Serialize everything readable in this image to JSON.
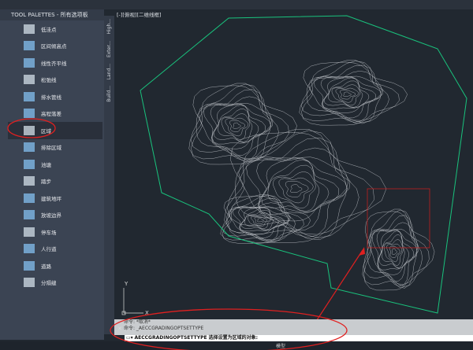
{
  "palette": {
    "title": "TOOL PALETTES - 所有选项板",
    "items": [
      {
        "label": "低洼点"
      },
      {
        "label": "区间倾高点"
      },
      {
        "label": "线性齐平线"
      },
      {
        "label": "松弛线"
      },
      {
        "label": "排水管线"
      },
      {
        "label": "高程落差"
      },
      {
        "label": "区域"
      },
      {
        "label": "排除区域"
      },
      {
        "label": "池塘"
      },
      {
        "label": "踏步"
      },
      {
        "label": "建筑地坪"
      },
      {
        "label": "放坡边界"
      },
      {
        "label": "停车场"
      },
      {
        "label": "人行道"
      },
      {
        "label": "道路"
      },
      {
        "label": "分隔缝"
      }
    ],
    "tabs": [
      "High...",
      "Exter...",
      "Land...",
      "Build..."
    ]
  },
  "viewport": {
    "label": "[-][俯视][二维线框]",
    "ucs_x": "X",
    "ucs_y": "Y"
  },
  "command": {
    "history": [
      "命令: *取消*",
      "命令: _AECCGRADINGOPTSETTYPE"
    ],
    "input": "AECCGRADINGOPTSETTYPE 选择设置为区域的对象:"
  },
  "status": {
    "model": "模型"
  },
  "colors": {
    "boundary": "#19c37d",
    "highlight": "#e02020",
    "contour": "#c8ccd0"
  }
}
